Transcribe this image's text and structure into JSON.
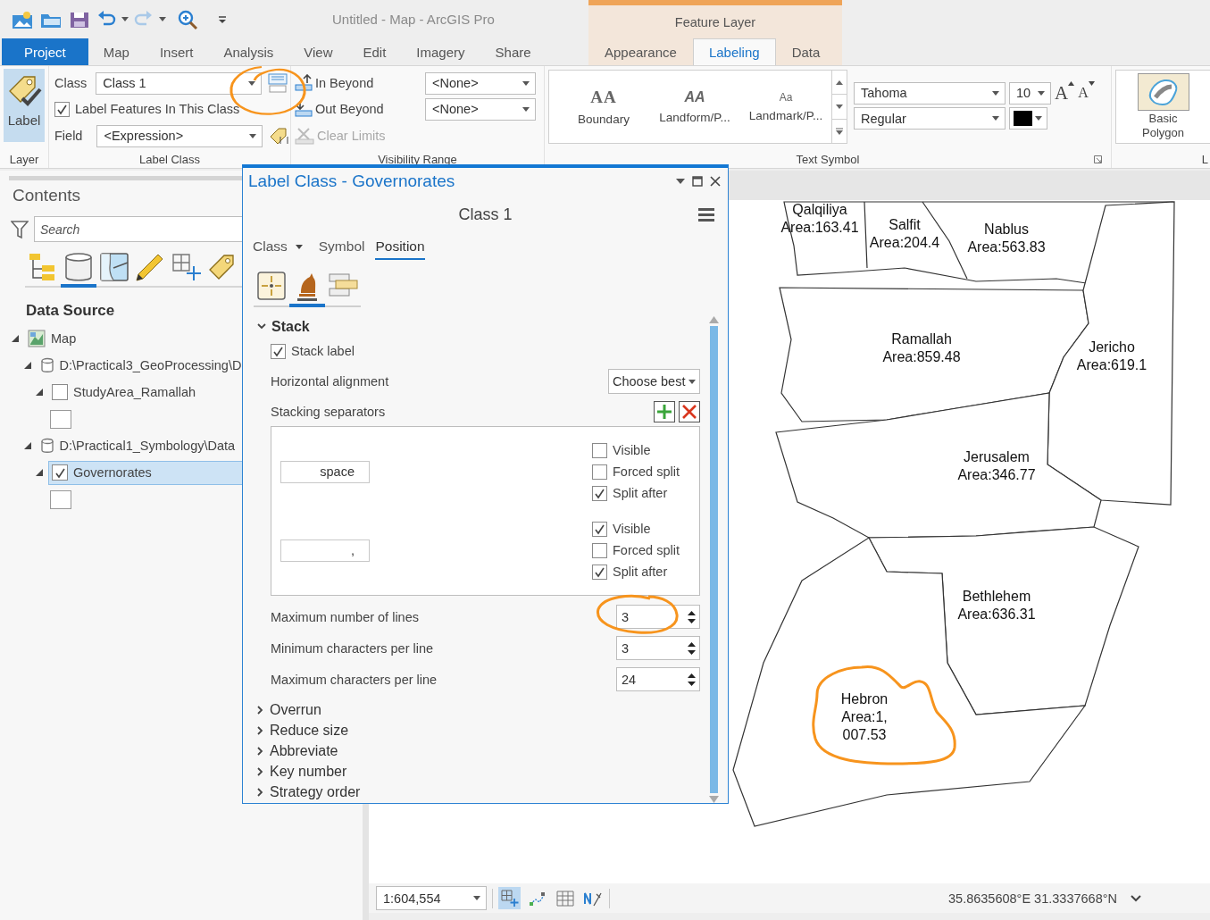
{
  "window": {
    "title": "Untitled - Map - ArcGIS Pro"
  },
  "contextual_group": {
    "title": "Feature Layer"
  },
  "tabs": [
    {
      "label": "Project",
      "kind": "file",
      "selected": false
    },
    {
      "label": "Map",
      "kind": "core",
      "selected": false
    },
    {
      "label": "Insert",
      "kind": "core",
      "selected": false
    },
    {
      "label": "Analysis",
      "kind": "core",
      "selected": false
    },
    {
      "label": "View",
      "kind": "core",
      "selected": false
    },
    {
      "label": "Edit",
      "kind": "core",
      "selected": false
    },
    {
      "label": "Imagery",
      "kind": "core",
      "selected": false
    },
    {
      "label": "Share",
      "kind": "core",
      "selected": false
    },
    {
      "label": "Appearance",
      "kind": "contextual",
      "selected": false
    },
    {
      "label": "Labeling",
      "kind": "contextual",
      "selected": true
    },
    {
      "label": "Data",
      "kind": "contextual",
      "selected": false
    }
  ],
  "ribbon": {
    "layer": {
      "label": "Layer",
      "button": {
        "label": "Label",
        "on": true
      }
    },
    "label_class": {
      "label": "Label Class",
      "class_label": "Class",
      "class_value": "Class 1",
      "label_features": {
        "label": "Label Features In This Class",
        "checked": true
      },
      "field_label": "Field",
      "field_value": "<Expression>"
    },
    "visibility_range": {
      "label": "Visibility Range",
      "rows": [
        {
          "kind": "in",
          "label": "In Beyond",
          "value": "<None>"
        },
        {
          "kind": "out",
          "label": "Out Beyond",
          "value": "<None>"
        }
      ],
      "clear": {
        "label": "Clear Limits",
        "disabled": true
      }
    },
    "text_symbol": {
      "label": "Text Symbol",
      "styles": [
        {
          "kind": "serif",
          "sample": "AA",
          "label": "Boundary"
        },
        {
          "kind": "italic",
          "sample": "AA",
          "label": "Landform/P..."
        },
        {
          "kind": "small",
          "sample": "Aa",
          "label": "Landmark/P..."
        }
      ],
      "font": "Tahoma",
      "size": "10",
      "style": "Regular",
      "grow_font": "A",
      "shrink_font": "A"
    },
    "placement": {
      "label": "L",
      "button": "Basic Polygon"
    }
  },
  "contents": {
    "title": "Contents",
    "search": {
      "placeholder": "Search"
    },
    "views": [
      {
        "kind": "drawing_order",
        "selected": false
      },
      {
        "kind": "data_source",
        "selected": true
      },
      {
        "kind": "selection",
        "selected": false
      },
      {
        "kind": "editing",
        "selected": false
      },
      {
        "kind": "snapping",
        "selected": false
      },
      {
        "kind": "labeling",
        "selected": false
      }
    ],
    "heading": "Data Source",
    "tree": [
      {
        "label": "Map",
        "kind": "map",
        "expanded": true,
        "selected": false,
        "children": [
          {
            "label": "D:\\Practical3_GeoProcessing\\D",
            "kind": "database",
            "expanded": true,
            "selected": false,
            "children": [
              {
                "label": "StudyArea_Ramallah",
                "kind": "layer",
                "expanded": true,
                "checked": false,
                "selected": false
              }
            ]
          },
          {
            "label": "D:\\Practical1_Symbology\\Data",
            "kind": "database",
            "expanded": true,
            "selected": false,
            "children": [
              {
                "label": "Governorates",
                "kind": "layer",
                "expanded": true,
                "checked": true,
                "selected": true
              }
            ]
          }
        ]
      }
    ]
  },
  "dialog": {
    "title": "Label Class - Governorates",
    "class_name": "Class 1",
    "tabs": [
      {
        "label": "Class",
        "kind": "dropdown",
        "selected": false
      },
      {
        "label": "Symbol",
        "kind": "plain",
        "selected": false
      },
      {
        "label": "Position",
        "kind": "plain",
        "selected": true
      }
    ],
    "subtabs": [
      {
        "kind": "placement",
        "selected": false
      },
      {
        "kind": "conflict",
        "selected": true
      },
      {
        "kind": "fitting",
        "selected": false
      }
    ],
    "stack": {
      "title": "Stack",
      "expanded": true,
      "stack_label": {
        "label": "Stack label",
        "checked": true
      },
      "alignment": {
        "label": "Horizontal alignment",
        "value": "Choose best"
      },
      "separators_label": "Stacking separators",
      "separators": [
        {
          "value": "space",
          "options": [
            {
              "label": "Visible",
              "checked": false
            },
            {
              "label": "Forced split",
              "checked": false
            },
            {
              "label": "Split after",
              "checked": true
            }
          ]
        },
        {
          "value": ",",
          "options": [
            {
              "label": "Visible",
              "checked": true
            },
            {
              "label": "Forced split",
              "checked": false
            },
            {
              "label": "Split after",
              "checked": true
            }
          ]
        }
      ],
      "spinners": [
        {
          "label": "Maximum number of lines",
          "value": "3"
        },
        {
          "label": "Minimum characters per line",
          "value": "3"
        },
        {
          "label": "Maximum characters per line",
          "value": "24"
        }
      ]
    },
    "sections": [
      {
        "title": "Overrun",
        "expanded": false
      },
      {
        "title": "Reduce size",
        "expanded": false
      },
      {
        "title": "Abbreviate",
        "expanded": false
      },
      {
        "title": "Key number",
        "expanded": false
      },
      {
        "title": "Strategy order",
        "expanded": false
      }
    ]
  },
  "map": {
    "labels": [
      {
        "lines": [
          "Qalqiliya",
          "Area:163.41"
        ]
      },
      {
        "lines": [
          "Salfit",
          "Area:204.4"
        ]
      },
      {
        "lines": [
          "Nablus",
          "Area:563.83"
        ]
      },
      {
        "lines": [
          "Ramallah",
          "Area:859.48"
        ]
      },
      {
        "lines": [
          "Jericho",
          "Area:619.1"
        ]
      },
      {
        "lines": [
          "Jerusalem",
          "Area:346.77"
        ]
      },
      {
        "lines": [
          "Bethlehem",
          "Area:636.31"
        ]
      },
      {
        "lines": [
          "Hebron",
          "Area:1,",
          "007.53"
        ]
      }
    ]
  },
  "status_bar": {
    "scale": "1:604,554",
    "tools": [
      {
        "kind": "grid",
        "on": true
      },
      {
        "kind": "snapping",
        "on": false
      },
      {
        "kind": "table",
        "on": false
      },
      {
        "kind": "north",
        "on": false
      }
    ],
    "coordinates": "35.8635608°E 31.3337668°N"
  }
}
